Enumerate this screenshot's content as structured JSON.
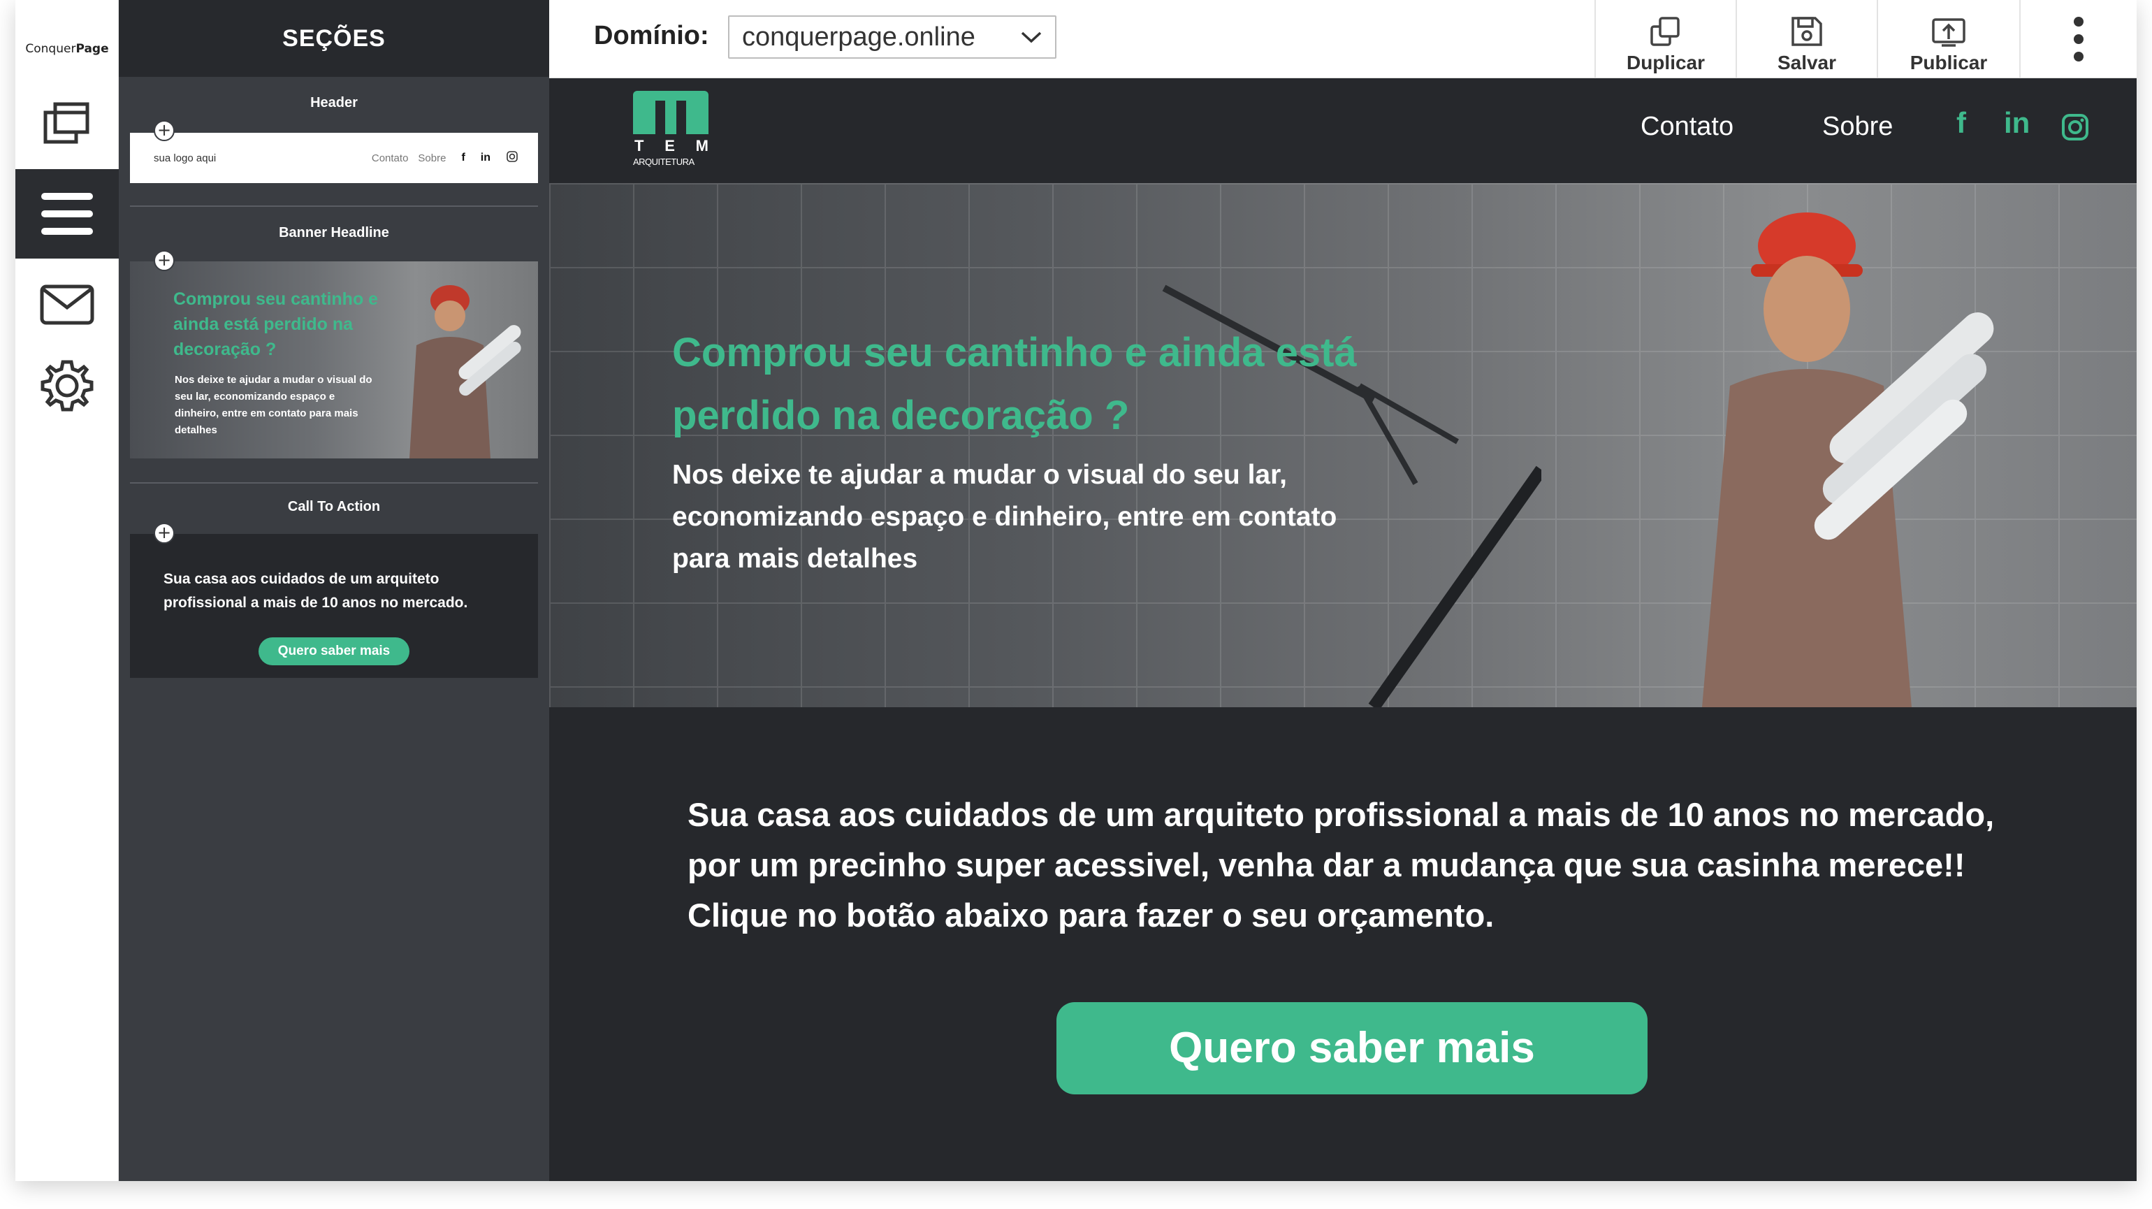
{
  "app": {
    "logo_prefix": "Conquer",
    "logo_suffix": "Page"
  },
  "rail": {
    "items": [
      {
        "icon": "pages-icon"
      },
      {
        "icon": "menu-icon",
        "active": true
      },
      {
        "icon": "mail-icon"
      },
      {
        "icon": "gear-icon"
      }
    ]
  },
  "panel": {
    "title": "SEÇÕES",
    "sections": [
      {
        "label": "Header"
      },
      {
        "label": "Banner Headline"
      },
      {
        "label": "Call To Action"
      }
    ],
    "header_thumb": {
      "logo_text": "sua logo aqui",
      "link1": "Contato",
      "link2": "Sobre",
      "social": [
        "f",
        "in",
        "ig"
      ]
    },
    "banner_thumb": {
      "headline": "Comprou seu cantinho e ainda está perdido na decoração ?",
      "body": "Nos deixe te ajudar a mudar o visual do seu lar, economizando espaço e dinheiro, entre em contato para mais detalhes"
    },
    "cta_thumb": {
      "text": "Sua casa aos cuidados de um arquiteto profissional a mais de 10 anos no mercado.",
      "button": "Quero saber mais"
    }
  },
  "toolbar": {
    "domain_label": "Domínio:",
    "domain_value": "conquerpage.online",
    "duplicate": "Duplicar",
    "save": "Salvar",
    "publish": "Publicar"
  },
  "preview": {
    "logo_letters": [
      "T",
      "E",
      "M"
    ],
    "logo_sub": "ARQUITETURA",
    "nav": [
      "Contato",
      "Sobre"
    ],
    "social": [
      "f",
      "in",
      "ig"
    ],
    "headline": "Comprou seu cantinho e ainda está perdido na decoração ?",
    "subtext": "Nos deixe te ajudar a mudar o visual do seu lar, economizando espaço e dinheiro, entre em contato para mais detalhes",
    "cta_text": "Sua casa aos cuidados de um arquiteto profissional a mais de 10 anos no mercado, por um precinho super acessivel, venha dar a mudança que sua casinha merece!! Clique no botão abaixo para fazer o seu orçamento.",
    "cta_button": "Quero saber mais"
  },
  "colors": {
    "accent": "#3fb98c",
    "dark": "#26282c",
    "panel": "#3a3d42"
  }
}
